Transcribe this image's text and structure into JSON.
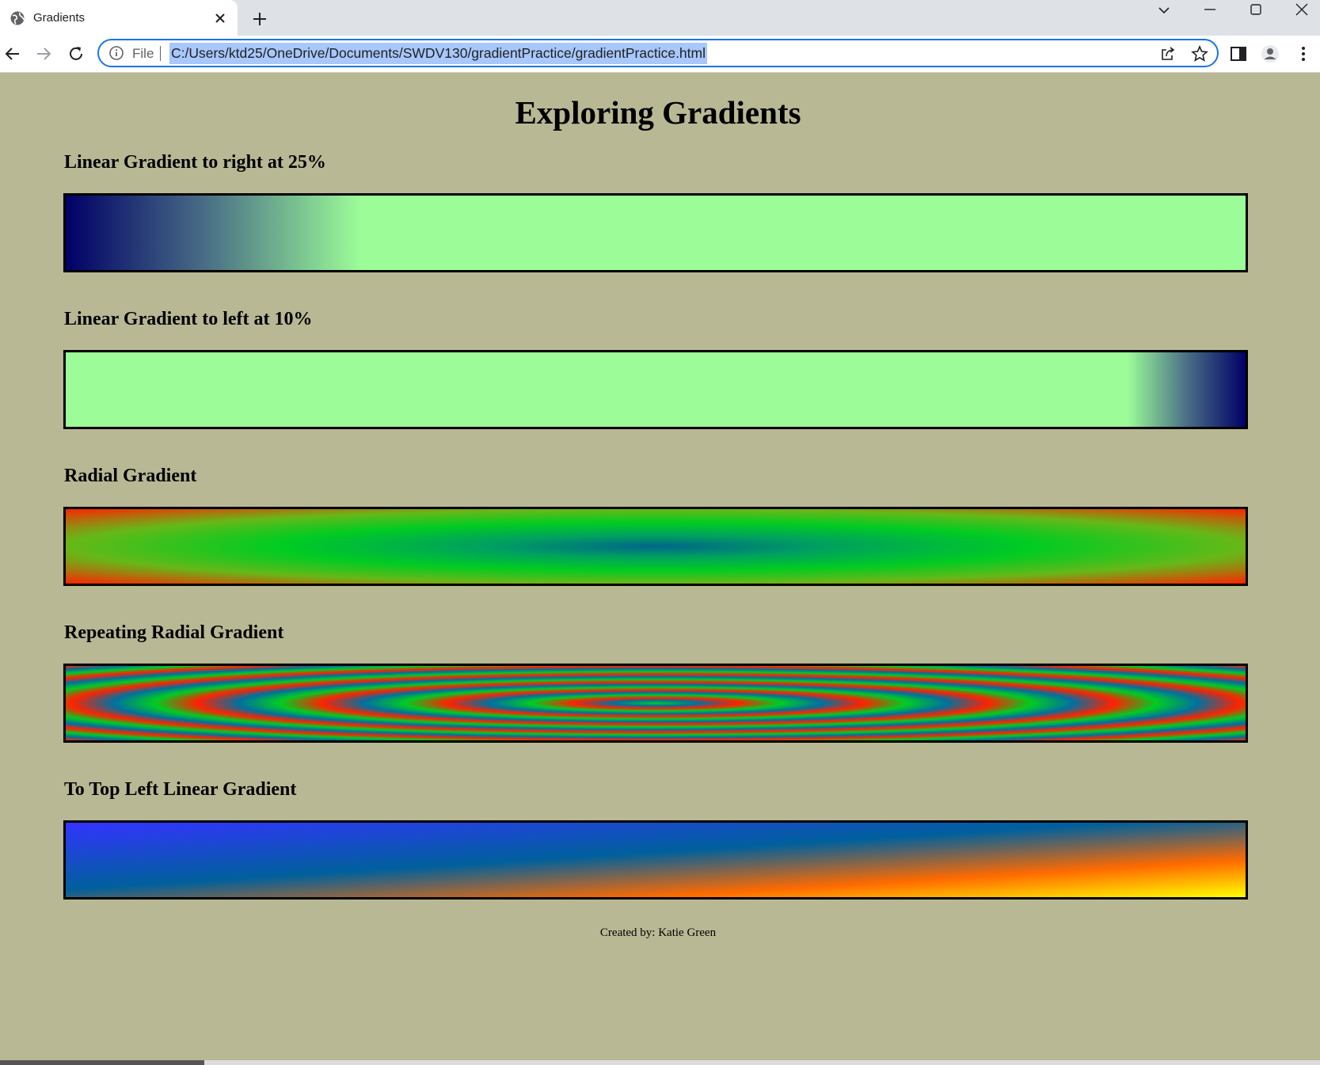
{
  "browser": {
    "tab_title": "Gradients",
    "address": {
      "scheme_label": "File",
      "url": "C:/Users/ktd25/OneDrive/Documents/SWDV130/gradientPractice/gradientPractice.html"
    }
  },
  "page": {
    "title": "Exploring Gradients",
    "sections": [
      {
        "heading": "Linear Gradient to right at 25%"
      },
      {
        "heading": "Linear Gradient to left at 10%"
      },
      {
        "heading": "Radial Gradient"
      },
      {
        "heading": "Repeating Radial Gradient"
      },
      {
        "heading": "To Top Left Linear Gradient"
      }
    ],
    "footer": "Created by: Katie Green"
  },
  "colors": {
    "page_background": "#b8b894",
    "navy": "#000066",
    "light_green": "#9cfc98",
    "green": "#00cc22",
    "red": "#ff2200",
    "blue": "#3333ff",
    "orange": "#ff6a00",
    "yellow": "#ffff00",
    "address_focus": "#1a73e8",
    "selection": "#a8c7fa"
  },
  "icons": {
    "tab": [
      "globe-icon",
      "close-icon",
      "plus-icon"
    ],
    "window": [
      "tab-search-icon",
      "minimize-icon",
      "maximize-icon",
      "window-close-icon"
    ],
    "navigation": [
      "back-arrow-icon",
      "forward-arrow-icon",
      "reload-icon"
    ],
    "omnibox": [
      "info-icon",
      "share-icon",
      "star-icon"
    ],
    "toolbar": [
      "side-panel-icon",
      "profile-icon",
      "menu-icon"
    ]
  }
}
